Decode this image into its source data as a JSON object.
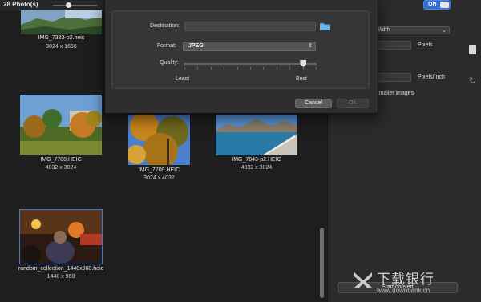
{
  "browser": {
    "photo_count": "28 Photo(s)",
    "tiles": [
      {
        "name": "IMG_7333-p2.heic",
        "size": "3024 x 1656"
      },
      {
        "name": "IMG_7708.HEIC",
        "size": "4032 x 3024"
      },
      {
        "name": "IMG_7709.HEIC",
        "size": "3024 x 4032"
      },
      {
        "name": "IMG_7843-p2.HEIC",
        "size": "4032 x 3024"
      },
      {
        "name": "random_collection_1440x960.heic",
        "size": "1440 x 960"
      }
    ]
  },
  "dialog": {
    "destination_label": "Destination:",
    "destination_value": "",
    "format_label": "Format:",
    "format_value": "JPEG",
    "quality_label": "Quality:",
    "quality_value": 0.9,
    "least_label": "Least",
    "best_label": "Best",
    "cancel_label": "Cancel",
    "ok_label": "OK"
  },
  "panel": {
    "toggle_label": "ON",
    "resize_mode": "y Width",
    "pixels_label": "Pixels",
    "pixels_inch_label": "Pixels/Inch",
    "smaller_images_label": "smaller images",
    "start_convert_label": "Start convert"
  },
  "watermark": {
    "text": "下载银行",
    "url": "www.downbank.cn"
  },
  "icons": {
    "folder": "folder-icon",
    "document": "document-icon",
    "refresh": "refresh-icon",
    "chevron": "chevron-updown-icon"
  },
  "colors": {
    "accent": "#2f6fd0",
    "folder": "#4fa3e3"
  }
}
